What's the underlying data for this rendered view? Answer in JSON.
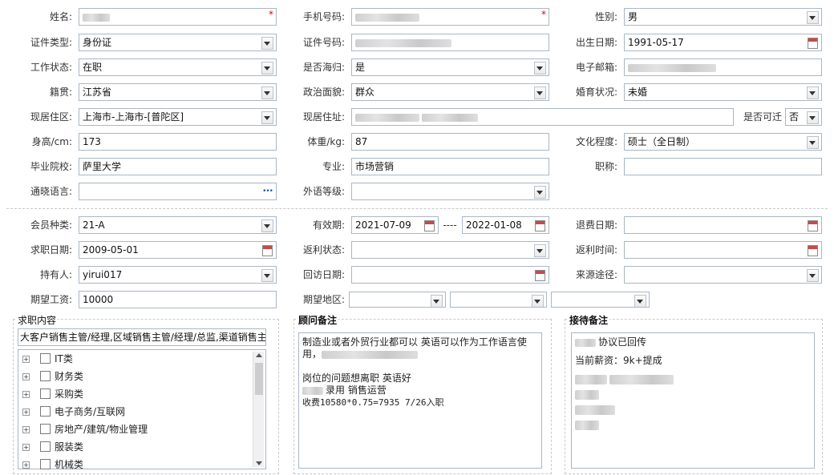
{
  "basic": {
    "name_label": "姓名:",
    "name_value": "",
    "mobile_label": "手机号码:",
    "mobile_value": "",
    "gender_label": "性别:",
    "gender_value": "男",
    "idtype_label": "证件类型:",
    "idtype_value": "身份证",
    "idno_label": "证件号码:",
    "idno_value": "",
    "birth_label": "出生日期:",
    "birth_value": "1991-05-17",
    "work_label": "工作状态:",
    "work_value": "在职",
    "returnee_label": "是否海归:",
    "returnee_value": "是",
    "email_label": "电子邮箱:",
    "email_value": "",
    "native_label": "籍贯:",
    "native_value": "江苏省",
    "politics_label": "政治面貌:",
    "politics_value": "群众",
    "marital_label": "婚育状况:",
    "marital_value": "未婚",
    "residence_label": "现居住区:",
    "residence_value": "上海市-上海市-[普陀区]",
    "address_label": "现居住址:",
    "address_value": "",
    "relocate_label": "是否可迁",
    "relocate_value": "否",
    "height_label": "身高/cm:",
    "height_value": "173",
    "weight_label": "体重/kg:",
    "weight_value": "87",
    "edu_label": "文化程度:",
    "edu_value": "硕士（全日制）",
    "school_label": "毕业院校:",
    "school_value": "萨里大学",
    "major_label": "专业:",
    "major_value": "市场营销",
    "title_label": "职称:",
    "title_value": "",
    "lang_label": "通晓语言:",
    "lang_value": "",
    "foreign_label": "外语等级:",
    "foreign_value": ""
  },
  "member": {
    "type_label": "会员种类:",
    "type_value": "21-A",
    "valid_label": "有效期:",
    "valid_from": "2021-07-09",
    "valid_sep": "----",
    "valid_to": "2022-01-08",
    "refund_label": "退费日期:",
    "refund_value": "",
    "jobdate_label": "求职日期:",
    "jobdate_value": "2009-05-01",
    "rebate_label": "返利状态:",
    "rebate_value": "",
    "rebate_time_label": "返利时间:",
    "rebate_time_value": "",
    "holder_label": "持有人:",
    "holder_value": "yirui017",
    "visit_label": "回访日期:",
    "visit_value": "",
    "source_label": "来源途径:",
    "source_value": "",
    "salary_label": "期望工资:",
    "salary_value": "10000",
    "region_label": "期望地区:"
  },
  "job_panel": {
    "title": "求职内容",
    "summary": "大客户销售主管/经理,区域销售主管/经理/总监,渠道销售主",
    "items": [
      "IT类",
      "财务类",
      "采购类",
      "电子商务/互联网",
      "房地产/建筑/物业管理",
      "服装类",
      "机械类"
    ],
    "expand_symbol": "+"
  },
  "advisor_panel": {
    "title": "顾问备注",
    "line1": "制造业或者外贸行业都可以 英语可以作为工作语言使",
    "line2": "用，",
    "line3": "岗位的问题想离职 英语好",
    "line4": "录用 销售运营",
    "line5": "收费10580*0.75=7935 7/26入职"
  },
  "reception_panel": {
    "title": "接待备注",
    "line1": "协议已回传",
    "line2": "当前薪资：9k+提成"
  }
}
